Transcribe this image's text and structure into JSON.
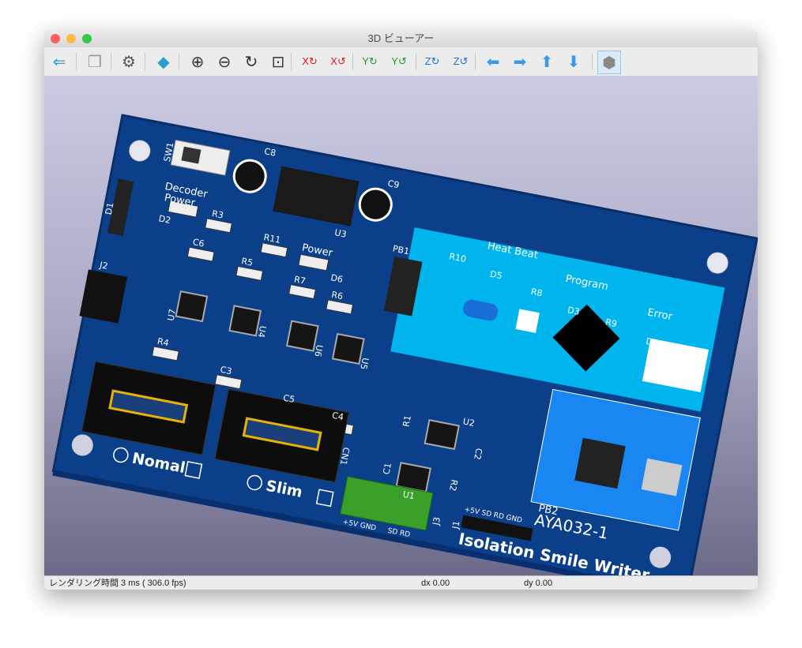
{
  "window": {
    "title": "3D ビューアー"
  },
  "toolbar": {
    "buttons": [
      {
        "name": "reload-board-button",
        "icon": "reload-board-icon",
        "glyph": "⇐"
      },
      {
        "name": "copy-to-clipboard-button",
        "icon": "copy-icon",
        "glyph": "❐"
      },
      {
        "name": "preferences-button",
        "icon": "gear-icon",
        "glyph": "⚙"
      },
      {
        "name": "raytracing-button",
        "icon": "cube-icon",
        "glyph": "◆"
      },
      {
        "name": "zoom-in-button",
        "icon": "zoom-in-icon",
        "glyph": "⊕"
      },
      {
        "name": "zoom-out-button",
        "icon": "zoom-out-icon",
        "glyph": "⊖"
      },
      {
        "name": "redraw-button",
        "icon": "refresh-icon",
        "glyph": "↻"
      },
      {
        "name": "zoom-fit-button",
        "icon": "zoom-fit-icon",
        "glyph": "⊡"
      },
      {
        "name": "rotate-x-cw-button",
        "icon": "rotate-x-icon",
        "glyph": "X↻"
      },
      {
        "name": "rotate-x-ccw-button",
        "icon": "rotate-x-icon",
        "glyph": "X↺"
      },
      {
        "name": "rotate-y-cw-button",
        "icon": "rotate-y-icon",
        "glyph": "Y↻"
      },
      {
        "name": "rotate-y-ccw-button",
        "icon": "rotate-y-icon",
        "glyph": "Y↺"
      },
      {
        "name": "rotate-z-cw-button",
        "icon": "rotate-z-icon",
        "glyph": "Z↻"
      },
      {
        "name": "rotate-z-ccw-button",
        "icon": "rotate-z-icon",
        "glyph": "Z↺"
      },
      {
        "name": "move-left-button",
        "icon": "arrow-left-icon",
        "glyph": "⬅"
      },
      {
        "name": "move-right-button",
        "icon": "arrow-right-icon",
        "glyph": "➡"
      },
      {
        "name": "move-up-button",
        "icon": "arrow-up-icon",
        "glyph": "⬆"
      },
      {
        "name": "move-down-button",
        "icon": "arrow-down-icon",
        "glyph": "⬇"
      },
      {
        "name": "toggle-orthographic-button",
        "icon": "cube-view-icon",
        "glyph": "⬢"
      }
    ]
  },
  "board": {
    "title": "Isolation Smile Writer",
    "revision": "AYA032-1",
    "labels": {
      "nomal": "Nomal",
      "slim": "Slim",
      "decoder_power": "Decoder",
      "power2": "Power",
      "heat_beat": "Heat Beat",
      "program": "Program",
      "error": "Error",
      "power": "Power",
      "terminal1": "+5V GND",
      "terminal2": "SD  RD",
      "header": "+5V SD RD GND"
    },
    "refs": [
      "SW1",
      "C8",
      "U3",
      "C9",
      "D1",
      "D2",
      "R3",
      "R11",
      "D6",
      "R10",
      "D5",
      "R8",
      "D3",
      "R9",
      "D4",
      "C6",
      "R5",
      "R7",
      "R6",
      "PB1",
      "J2",
      "U7",
      "U4",
      "U6",
      "U5",
      "R4",
      "C3",
      "C5",
      "C4",
      "CN1",
      "R1",
      "U2",
      "C2",
      "C1",
      "U1",
      "R2",
      "J3",
      "J1",
      "PB2"
    ]
  },
  "status": {
    "render_time": "レンダリング時間 3 ms ( 306.0 fps)",
    "dx": "dx 0.00",
    "dy": "dy 0.00"
  }
}
